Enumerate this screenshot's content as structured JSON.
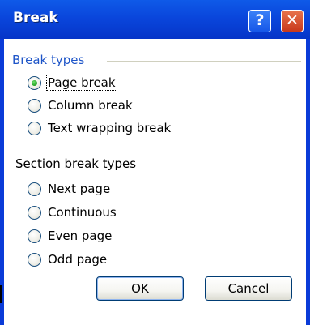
{
  "dialog": {
    "title": "Break",
    "help_symbol": "?",
    "close_symbol": "✕"
  },
  "break_types": {
    "label": "Break types",
    "options": [
      {
        "label": "Page break",
        "selected": true
      },
      {
        "label": "Column break",
        "selected": false
      },
      {
        "label": "Text wrapping break",
        "selected": false
      }
    ]
  },
  "section_break_types": {
    "label": "Section break types",
    "options": [
      {
        "label": "Next page",
        "selected": false
      },
      {
        "label": "Continuous",
        "selected": false
      },
      {
        "label": "Even page",
        "selected": false
      },
      {
        "label": "Odd page",
        "selected": false
      }
    ]
  },
  "buttons": {
    "ok": "OK",
    "cancel": "Cancel"
  },
  "colors": {
    "title_bar": "#0a46dc",
    "group_label": "#1e55c8",
    "radio_selected": "#21a121"
  }
}
